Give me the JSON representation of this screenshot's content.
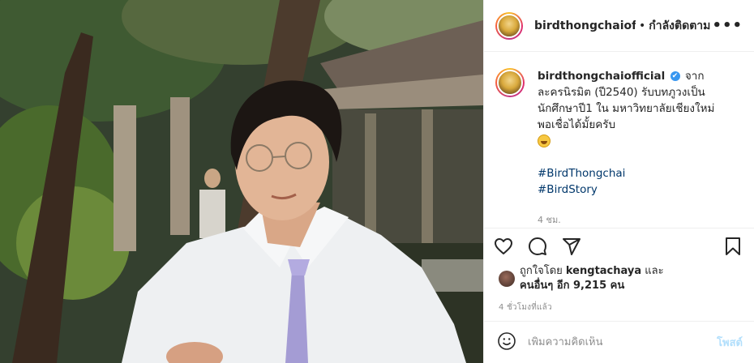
{
  "header": {
    "username": "birdthongchaiofficial",
    "separator": "•",
    "following_label": "กำลังติดตาม",
    "more_label": "•••"
  },
  "caption": {
    "username": "birdthongchaiofficial",
    "verified_mark": "✔",
    "text": "จากละครนิรมิต (ปี2540) รับบทภูวงเป็นนักศึกษาปี1 ใน มหาวิทยาลัยเชียงใหม่ พอเชื่อได้มั้ยครับ",
    "emoji": "grinning-face-emoji",
    "hashtags": [
      "#BirdThongchai",
      "#BirdStory"
    ],
    "time": "4 ชม."
  },
  "actions": {
    "icons": [
      "heart-icon",
      "comment-icon",
      "share-icon",
      "bookmark-icon"
    ]
  },
  "likes": {
    "prefix": "ถูกใจโดย",
    "liker": "kengtachaya",
    "and": "และ",
    "others": "คนอื่นๆ อีก 9,215 คน"
  },
  "post_time": "4 ชั่วโมงที่แล้ว",
  "comment_box": {
    "placeholder": "เพิ่มความคิดเห็น",
    "post_label": "โพสต์"
  },
  "colors": {
    "link": "#00376b",
    "verified": "#3897f0",
    "muted": "#8e8e8e",
    "post_button": "#b2dffc"
  }
}
